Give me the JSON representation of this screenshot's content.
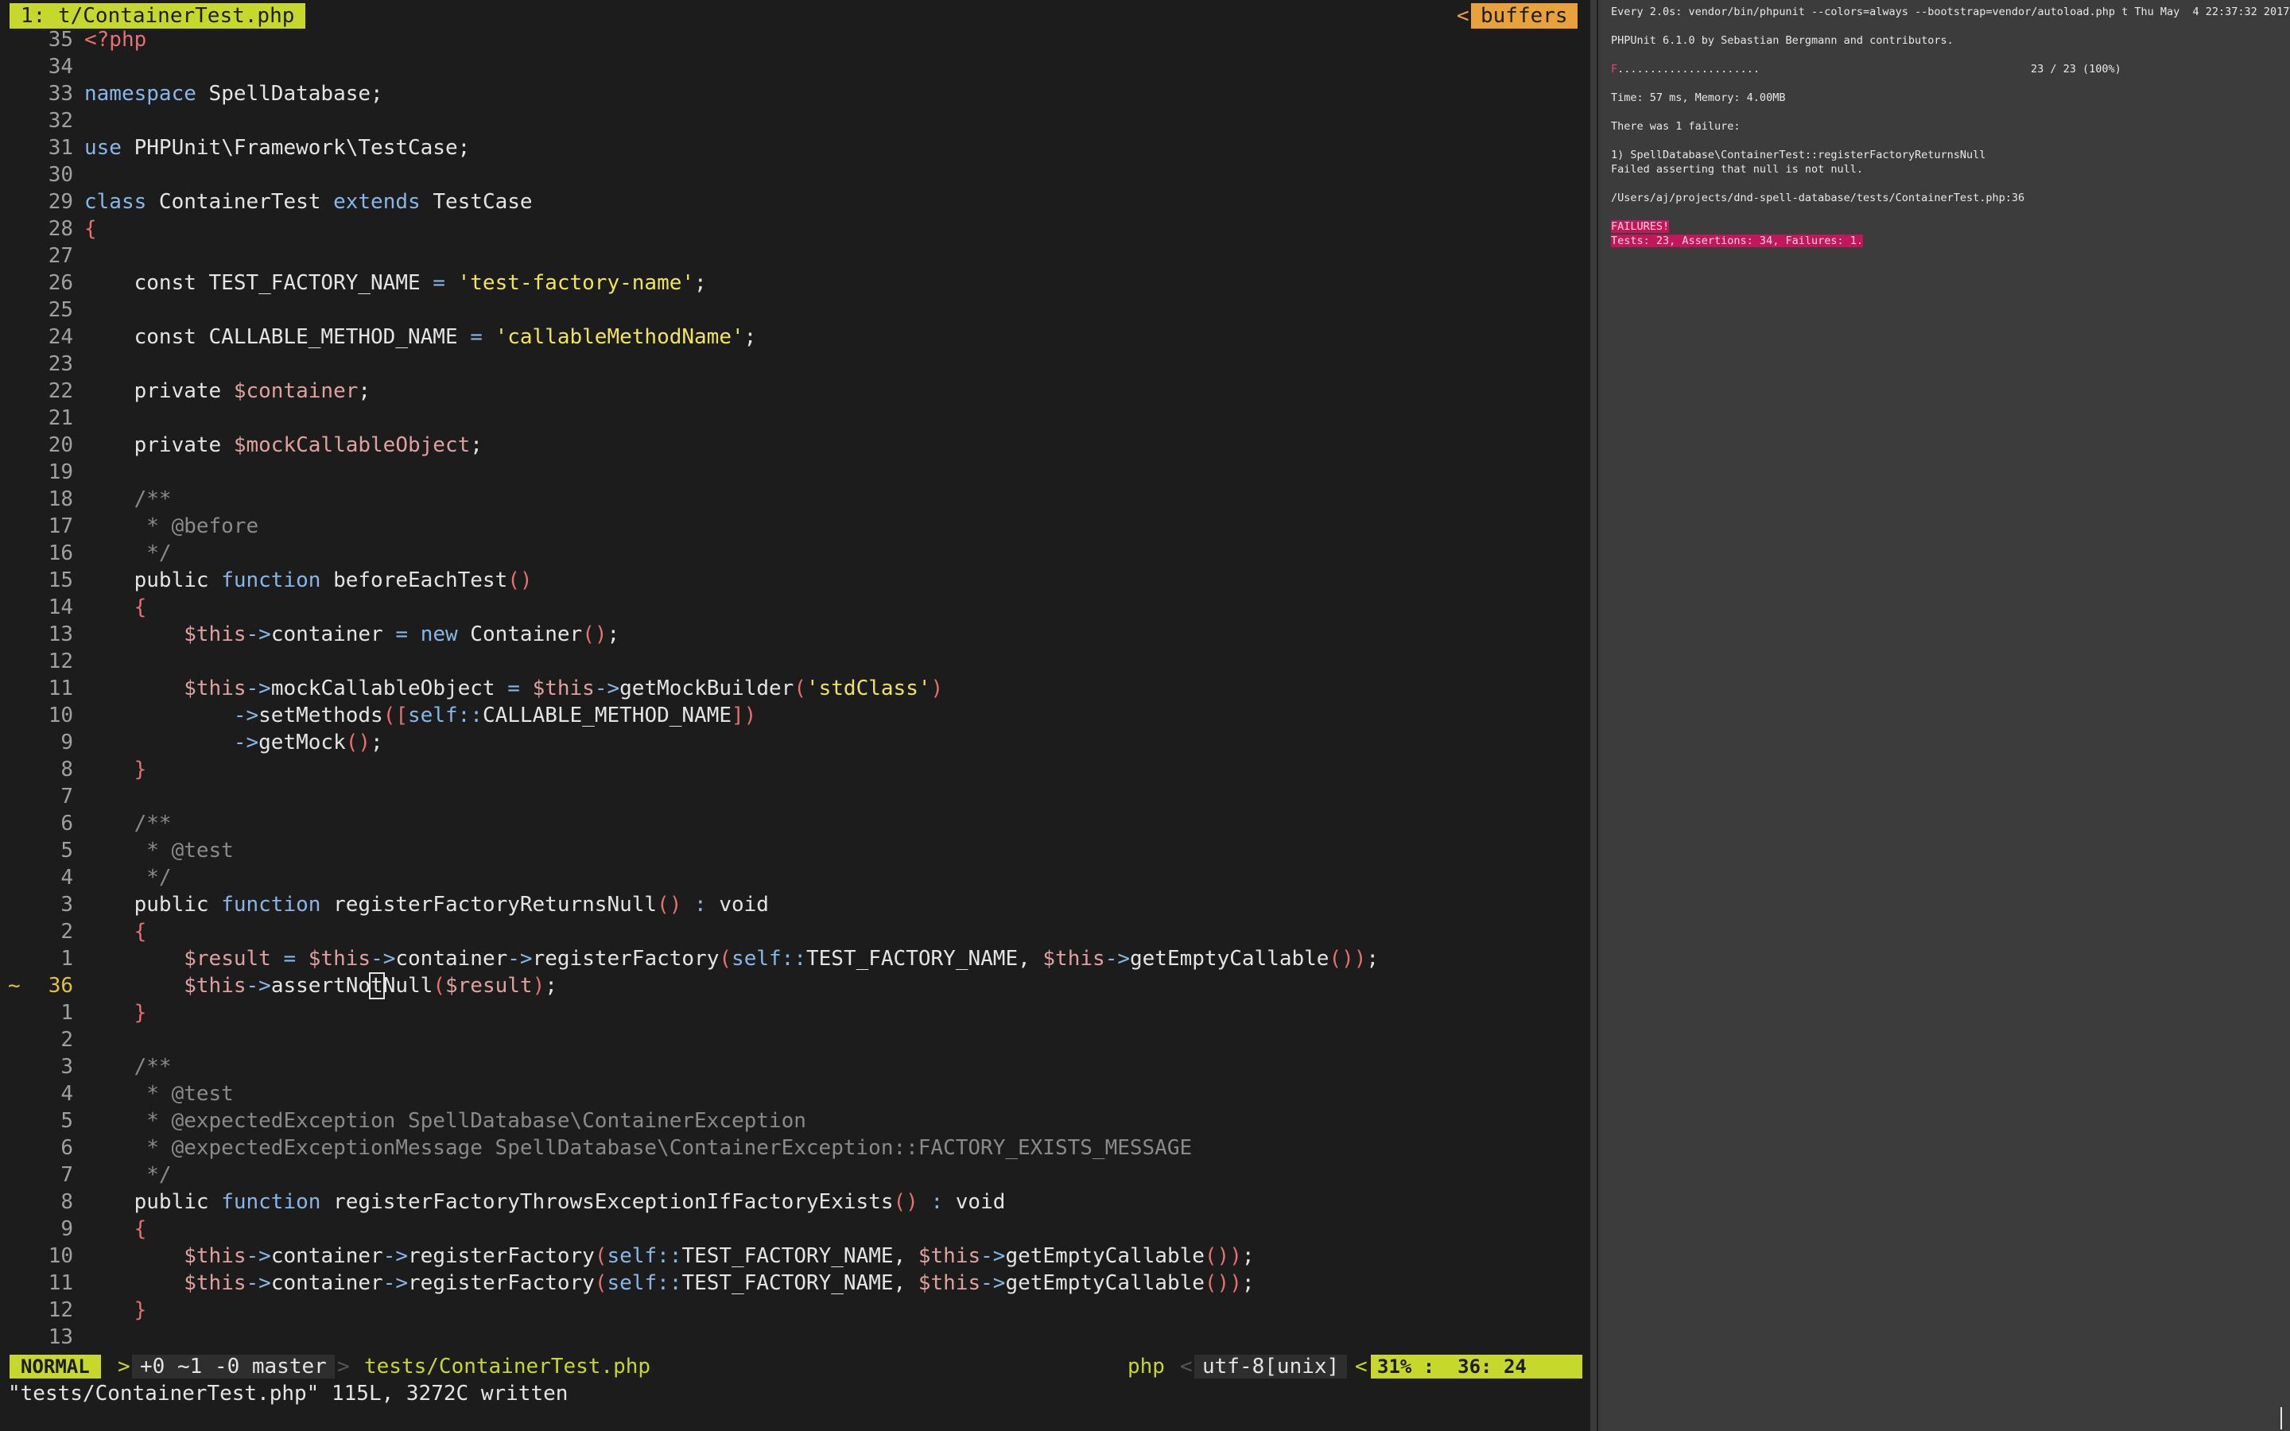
{
  "tabline": {
    "active_tab": "1: t/ContainerTest.php",
    "buffers_arrow": "<",
    "buffers_label": "buffers"
  },
  "editor": {
    "lines": [
      {
        "n": "35",
        "t": [
          [
            "<?php",
            "brk"
          ]
        ]
      },
      {
        "n": "34",
        "t": []
      },
      {
        "n": "33",
        "t": [
          [
            "namespace",
            "kw"
          ],
          [
            " SpellDatabase;",
            ""
          ]
        ]
      },
      {
        "n": "32",
        "t": []
      },
      {
        "n": "31",
        "t": [
          [
            "use",
            "kw"
          ],
          [
            " PHPUnit\\Framework\\TestCase;",
            ""
          ]
        ]
      },
      {
        "n": "30",
        "t": []
      },
      {
        "n": "29",
        "t": [
          [
            "class",
            "kw"
          ],
          [
            " ContainerTest ",
            ""
          ],
          [
            "extends",
            "kw"
          ],
          [
            " TestCase",
            ""
          ]
        ]
      },
      {
        "n": "28",
        "t": [
          [
            "{",
            "brk"
          ]
        ]
      },
      {
        "n": "27",
        "t": []
      },
      {
        "n": "26",
        "t": [
          [
            "    const TEST_FACTORY_NAME ",
            ""
          ],
          [
            "=",
            "op"
          ],
          [
            " ",
            ""
          ],
          [
            "'test-factory-name'",
            "str"
          ],
          [
            ";",
            ""
          ]
        ]
      },
      {
        "n": "25",
        "t": []
      },
      {
        "n": "24",
        "t": [
          [
            "    const CALLABLE_METHOD_NAME ",
            ""
          ],
          [
            "=",
            "op"
          ],
          [
            " ",
            ""
          ],
          [
            "'callableMethodName'",
            "str"
          ],
          [
            ";",
            ""
          ]
        ]
      },
      {
        "n": "23",
        "t": []
      },
      {
        "n": "22",
        "t": [
          [
            "    private ",
            ""
          ],
          [
            "$container",
            "var"
          ],
          [
            ";",
            ""
          ]
        ]
      },
      {
        "n": "21",
        "t": []
      },
      {
        "n": "20",
        "t": [
          [
            "    private ",
            ""
          ],
          [
            "$mockCallableObject",
            "var"
          ],
          [
            ";",
            ""
          ]
        ]
      },
      {
        "n": "19",
        "t": []
      },
      {
        "n": "18",
        "t": [
          [
            "    /**",
            "cm"
          ]
        ]
      },
      {
        "n": "17",
        "t": [
          [
            "     * @before",
            "cm"
          ]
        ]
      },
      {
        "n": "16",
        "t": [
          [
            "     */",
            "cm"
          ]
        ]
      },
      {
        "n": "15",
        "t": [
          [
            "    public ",
            ""
          ],
          [
            "function",
            "kw"
          ],
          [
            " beforeEachTest",
            ""
          ],
          [
            "()",
            "brk"
          ]
        ]
      },
      {
        "n": "14",
        "t": [
          [
            "    {",
            "brk"
          ]
        ]
      },
      {
        "n": "13",
        "t": [
          [
            "        ",
            ""
          ],
          [
            "$this",
            "var"
          ],
          [
            "->",
            "op"
          ],
          [
            "container ",
            ""
          ],
          [
            "=",
            "op"
          ],
          [
            " ",
            ""
          ],
          [
            "new",
            "kw"
          ],
          [
            " Container",
            ""
          ],
          [
            "()",
            "brk"
          ],
          [
            ";",
            ""
          ]
        ]
      },
      {
        "n": "12",
        "t": []
      },
      {
        "n": "11",
        "t": [
          [
            "        ",
            ""
          ],
          [
            "$this",
            "var"
          ],
          [
            "->",
            "op"
          ],
          [
            "mockCallableObject ",
            ""
          ],
          [
            "=",
            "op"
          ],
          [
            " ",
            ""
          ],
          [
            "$this",
            "var"
          ],
          [
            "->",
            "op"
          ],
          [
            "getMockBuilder",
            ""
          ],
          [
            "(",
            "brk"
          ],
          [
            "'stdClass'",
            "str"
          ],
          [
            ")",
            "brk"
          ]
        ]
      },
      {
        "n": "10",
        "t": [
          [
            "            ",
            ""
          ],
          [
            "->",
            "op"
          ],
          [
            "setMethods",
            ""
          ],
          [
            "([",
            "brk"
          ],
          [
            "self",
            "kw"
          ],
          [
            "::",
            "op"
          ],
          [
            "CALLABLE_METHOD_NAME",
            ""
          ],
          [
            "])",
            "brk"
          ]
        ]
      },
      {
        "n": "9",
        "t": [
          [
            "            ",
            ""
          ],
          [
            "->",
            "op"
          ],
          [
            "getMock",
            ""
          ],
          [
            "()",
            "brk"
          ],
          [
            ";",
            ""
          ]
        ]
      },
      {
        "n": "8",
        "t": [
          [
            "    }",
            "brk"
          ]
        ]
      },
      {
        "n": "7",
        "t": []
      },
      {
        "n": "6",
        "t": [
          [
            "    /**",
            "cm"
          ]
        ]
      },
      {
        "n": "5",
        "t": [
          [
            "     * @test",
            "cm"
          ]
        ]
      },
      {
        "n": "4",
        "t": [
          [
            "     */",
            "cm"
          ]
        ]
      },
      {
        "n": "3",
        "t": [
          [
            "    public ",
            ""
          ],
          [
            "function",
            "kw"
          ],
          [
            " registerFactoryReturnsNull",
            ""
          ],
          [
            "()",
            "brk"
          ],
          [
            " ",
            ""
          ],
          [
            ":",
            "op"
          ],
          [
            " void",
            ""
          ]
        ]
      },
      {
        "n": "2",
        "t": [
          [
            "    {",
            "brk"
          ]
        ]
      },
      {
        "n": "1",
        "t": [
          [
            "        ",
            ""
          ],
          [
            "$result",
            "var"
          ],
          [
            " ",
            ""
          ],
          [
            "=",
            "op"
          ],
          [
            " ",
            ""
          ],
          [
            "$this",
            "var"
          ],
          [
            "->",
            "op"
          ],
          [
            "container",
            ""
          ],
          [
            "->",
            "op"
          ],
          [
            "registerFactory",
            ""
          ],
          [
            "(",
            "brk"
          ],
          [
            "self",
            "kw"
          ],
          [
            "::",
            "op"
          ],
          [
            "TEST_FACTORY_NAME, ",
            ""
          ],
          [
            "$this",
            "var"
          ],
          [
            "->",
            "op"
          ],
          [
            "getEmptyCallable",
            ""
          ],
          [
            "())",
            "brk"
          ],
          [
            ";",
            ""
          ]
        ]
      },
      {
        "n": "36",
        "cur": true,
        "mark": "~",
        "t": [
          [
            "        ",
            ""
          ],
          [
            "$this",
            "var"
          ],
          [
            "->",
            "op"
          ],
          [
            "assertNo",
            ""
          ],
          [
            "t",
            "cursor"
          ],
          [
            "Null",
            ""
          ],
          [
            "(",
            "brk"
          ],
          [
            "$result",
            "var"
          ],
          [
            ")",
            "brk"
          ],
          [
            ";",
            ""
          ]
        ]
      },
      {
        "n": "1",
        "t": [
          [
            "    }",
            "brk"
          ]
        ]
      },
      {
        "n": "2",
        "t": []
      },
      {
        "n": "3",
        "t": [
          [
            "    /**",
            "cm"
          ]
        ]
      },
      {
        "n": "4",
        "t": [
          [
            "     * @test",
            "cm"
          ]
        ]
      },
      {
        "n": "5",
        "t": [
          [
            "     * @expectedException SpellDatabase\\ContainerException",
            "cm"
          ]
        ]
      },
      {
        "n": "6",
        "t": [
          [
            "     * @expectedExceptionMessage SpellDatabase\\ContainerException::FACTORY_EXISTS_MESSAGE",
            "cm"
          ]
        ]
      },
      {
        "n": "7",
        "t": [
          [
            "     */",
            "cm"
          ]
        ]
      },
      {
        "n": "8",
        "t": [
          [
            "    public ",
            ""
          ],
          [
            "function",
            "kw"
          ],
          [
            " registerFactoryThrowsExceptionIfFactoryExists",
            ""
          ],
          [
            "()",
            "brk"
          ],
          [
            " ",
            ""
          ],
          [
            ":",
            "op"
          ],
          [
            " void",
            ""
          ]
        ]
      },
      {
        "n": "9",
        "t": [
          [
            "    {",
            "brk"
          ]
        ]
      },
      {
        "n": "10",
        "t": [
          [
            "        ",
            ""
          ],
          [
            "$this",
            "var"
          ],
          [
            "->",
            "op"
          ],
          [
            "container",
            ""
          ],
          [
            "->",
            "op"
          ],
          [
            "registerFactory",
            ""
          ],
          [
            "(",
            "brk"
          ],
          [
            "self",
            "kw"
          ],
          [
            "::",
            "op"
          ],
          [
            "TEST_FACTORY_NAME, ",
            ""
          ],
          [
            "$this",
            "var"
          ],
          [
            "->",
            "op"
          ],
          [
            "getEmptyCallable",
            ""
          ],
          [
            "())",
            "brk"
          ],
          [
            ";",
            ""
          ]
        ]
      },
      {
        "n": "11",
        "t": [
          [
            "        ",
            ""
          ],
          [
            "$this",
            "var"
          ],
          [
            "->",
            "op"
          ],
          [
            "container",
            ""
          ],
          [
            "->",
            "op"
          ],
          [
            "registerFactory",
            ""
          ],
          [
            "(",
            "brk"
          ],
          [
            "self",
            "kw"
          ],
          [
            "::",
            "op"
          ],
          [
            "TEST_FACTORY_NAME, ",
            ""
          ],
          [
            "$this",
            "var"
          ],
          [
            "->",
            "op"
          ],
          [
            "getEmptyCallable",
            ""
          ],
          [
            "())",
            "brk"
          ],
          [
            ";",
            ""
          ]
        ]
      },
      {
        "n": "12",
        "t": [
          [
            "    }",
            "brk"
          ]
        ]
      },
      {
        "n": "13",
        "t": []
      }
    ]
  },
  "statusline": {
    "mode": "NORMAL",
    "sep_right": ">",
    "git": "+0 ~1 -0 master",
    "sep_thin_right": ">",
    "file": "tests/ContainerTest.php",
    "filetype": "php",
    "sep_thin_left": "<",
    "encoding": "utf-8[unix]",
    "sep_left": "<",
    "position": "31% :  36: 24"
  },
  "cmdline": "\"tests/ContainerTest.php\" 115L, 3272C written",
  "terminal": {
    "header": "Every 2.0s: vendor/bin/phpunit --colors=always --bootstrap=vendor/autoload.php t Thu May  4 22:37:32 2017",
    "phpunit_version": "PHPUnit 6.1.0 by Sebastian Bergmann and contributors.",
    "progress_fail": "F",
    "progress_dots": "......................",
    "progress_count": "23 / 23 (100%)",
    "time_memory": "Time: 57 ms, Memory: 4.00MB",
    "failure_count": "There was 1 failure:",
    "failure_title": "1) SpellDatabase\\ContainerTest::registerFactoryReturnsNull",
    "failure_message": "Failed asserting that null is not null.",
    "failure_location": "/Users/aj/projects/dnd-spell-database/tests/ContainerTest.php:36",
    "failures_label": "FAILURES!",
    "summary": "Tests: 23, Assertions: 34, Failures: 1."
  },
  "colors": {
    "accent_green": "#c6d82b",
    "accent_orange": "#e9a23b",
    "failure_red": "#c2185b"
  }
}
